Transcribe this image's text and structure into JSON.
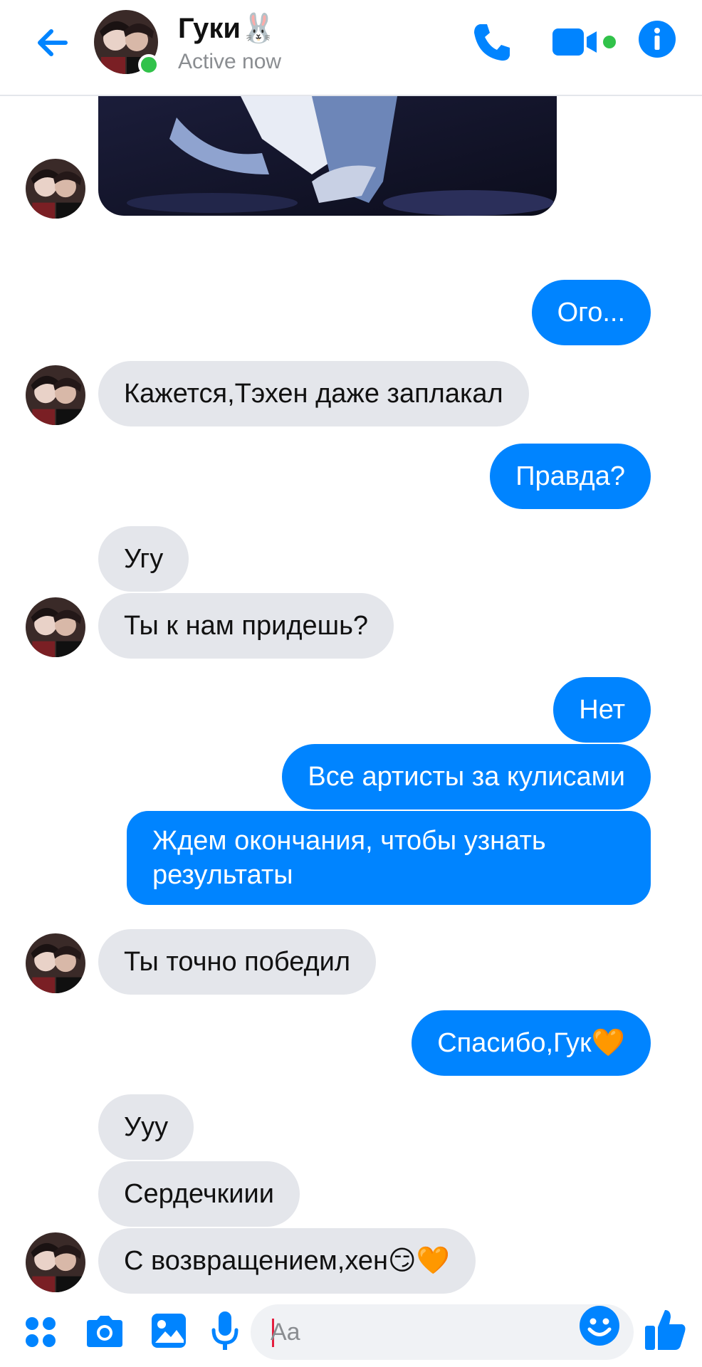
{
  "header": {
    "title": "Гуки🐰",
    "status": "Active now",
    "accent_color": "#0084ff",
    "online_color": "#31c24a"
  },
  "messages": [
    {
      "side": "out",
      "text": "Ого..."
    },
    {
      "side": "in",
      "text": "Кажется,Тэхен даже заплакал"
    },
    {
      "side": "out",
      "text": "Правда?"
    },
    {
      "side": "in",
      "text": "Угу"
    },
    {
      "side": "in",
      "text": "Ты к нам придешь?"
    },
    {
      "side": "out",
      "text": "Нет"
    },
    {
      "side": "out",
      "text": "Все артисты за кулисами"
    },
    {
      "side": "out",
      "text": "Ждем окончания, чтобы узнать результаты"
    },
    {
      "side": "in",
      "text": "Ты точно победил"
    },
    {
      "side": "out",
      "text": "Спасибо,Гук🧡"
    },
    {
      "side": "in",
      "text": "Ууу"
    },
    {
      "side": "in",
      "text": "Сердечкиии"
    },
    {
      "side": "in",
      "text": "С возвращением,хен😏🧡"
    }
  ],
  "composer": {
    "placeholder": "Aa",
    "icons": [
      "apps-icon",
      "camera-icon",
      "gallery-icon",
      "microphone-icon",
      "emoji-icon",
      "thumbs-up-icon"
    ]
  }
}
